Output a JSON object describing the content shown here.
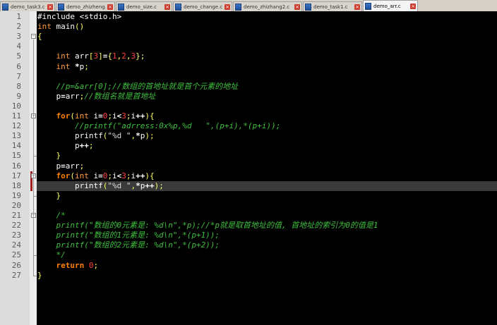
{
  "tabs": [
    {
      "label": "demo_task3.c",
      "active": false
    },
    {
      "label": "demo_zhizheng.c",
      "active": false
    },
    {
      "label": "demo_size.c",
      "active": false
    },
    {
      "label": "demo_change.c",
      "active": false
    },
    {
      "label": "demo_zhizhang2.c",
      "active": false
    },
    {
      "label": "demo_task1.c",
      "active": false
    },
    {
      "label": "demo_arr.c",
      "active": true
    }
  ],
  "current_line": 18,
  "lines": [
    {
      "n": "1",
      "tokens": [
        [
          "fn",
          "#include <stdio.h>"
        ]
      ]
    },
    {
      "n": "2",
      "tokens": [
        [
          "type",
          "int"
        ],
        [
          "fn",
          " main"
        ],
        [
          "sep",
          "()"
        ]
      ]
    },
    {
      "n": "3",
      "tokens": [
        [
          "sep",
          "{"
        ]
      ]
    },
    {
      "n": "4",
      "tokens": []
    },
    {
      "n": "5",
      "tokens": [
        [
          "type",
          "    int"
        ],
        [
          "fn",
          " arr"
        ],
        [
          "sep",
          "["
        ],
        [
          "num",
          "3"
        ],
        [
          "sep",
          "]"
        ],
        [
          "op",
          "="
        ],
        [
          "sep",
          "{"
        ],
        [
          "num",
          "1"
        ],
        [
          "sep",
          ","
        ],
        [
          "num",
          "2"
        ],
        [
          "sep",
          ","
        ],
        [
          "num",
          "3"
        ],
        [
          "sep",
          "};"
        ]
      ]
    },
    {
      "n": "6",
      "tokens": [
        [
          "type",
          "    int"
        ],
        [
          "op",
          " *"
        ],
        [
          "fn",
          "p"
        ],
        [
          "sep",
          ";"
        ]
      ]
    },
    {
      "n": "7",
      "tokens": []
    },
    {
      "n": "8",
      "tokens": [
        [
          "cmt",
          "    //p=&arr[0];//数组的首地址就是首个元素的地址"
        ]
      ]
    },
    {
      "n": "9",
      "tokens": [
        [
          "fn",
          "    p"
        ],
        [
          "op",
          "="
        ],
        [
          "fn",
          "arr"
        ],
        [
          "sep",
          ";"
        ],
        [
          "cmt",
          "//数组名就是首地址"
        ]
      ]
    },
    {
      "n": "10",
      "tokens": []
    },
    {
      "n": "11",
      "tokens": [
        [
          "kw",
          "    for"
        ],
        [
          "sep",
          "("
        ],
        [
          "type",
          "int"
        ],
        [
          "fn",
          " i"
        ],
        [
          "op",
          "="
        ],
        [
          "num",
          "0"
        ],
        [
          "sep",
          ";"
        ],
        [
          "fn",
          "i"
        ],
        [
          "op",
          "<"
        ],
        [
          "num",
          "3"
        ],
        [
          "sep",
          ";"
        ],
        [
          "fn",
          "i"
        ],
        [
          "op",
          "++"
        ],
        [
          "sep",
          "){"
        ]
      ]
    },
    {
      "n": "12",
      "tokens": [
        [
          "cmt",
          "        //printf(\"adrress:0x%p,%d   \",(p+i),*(p+i));"
        ]
      ]
    },
    {
      "n": "13",
      "tokens": [
        [
          "fn",
          "        printf"
        ],
        [
          "sep",
          "("
        ],
        [
          "str",
          "\"%d \""
        ],
        [
          "sep",
          ","
        ],
        [
          "op",
          "*"
        ],
        [
          "fn",
          "p"
        ],
        [
          "sep",
          ");"
        ]
      ]
    },
    {
      "n": "14",
      "tokens": [
        [
          "fn",
          "        p"
        ],
        [
          "op",
          "++"
        ],
        [
          "sep",
          ";"
        ]
      ]
    },
    {
      "n": "15",
      "tokens": [
        [
          "sep",
          "    }"
        ]
      ]
    },
    {
      "n": "16",
      "tokens": [
        [
          "fn",
          "    p"
        ],
        [
          "op",
          "="
        ],
        [
          "fn",
          "arr"
        ],
        [
          "sep",
          ";"
        ]
      ]
    },
    {
      "n": "17",
      "tokens": [
        [
          "kw",
          "    for"
        ],
        [
          "sep",
          "("
        ],
        [
          "type",
          "int"
        ],
        [
          "fn",
          " i"
        ],
        [
          "op",
          "="
        ],
        [
          "num",
          "0"
        ],
        [
          "sep",
          ";"
        ],
        [
          "fn",
          "i"
        ],
        [
          "op",
          "<"
        ],
        [
          "num",
          "3"
        ],
        [
          "sep",
          ";"
        ],
        [
          "fn",
          "i"
        ],
        [
          "op",
          "++"
        ],
        [
          "sep",
          "){"
        ]
      ]
    },
    {
      "n": "18",
      "tokens": [
        [
          "fn",
          "        printf"
        ],
        [
          "sep",
          "("
        ],
        [
          "str",
          "\"%d \""
        ],
        [
          "sep",
          ","
        ],
        [
          "op",
          "*"
        ],
        [
          "fn",
          "p"
        ],
        [
          "op",
          "++"
        ],
        [
          "sep",
          ");"
        ]
      ]
    },
    {
      "n": "19",
      "tokens": [
        [
          "sep",
          "    }"
        ]
      ]
    },
    {
      "n": "20",
      "tokens": []
    },
    {
      "n": "21",
      "tokens": [
        [
          "cmt",
          "    /*"
        ]
      ]
    },
    {
      "n": "22",
      "tokens": [
        [
          "cmt",
          "    printf(\"数组的0元素是: %d\\n\",*p);//*p就是取首地址的值, 首地址的索引为0的值是1"
        ]
      ]
    },
    {
      "n": "23",
      "tokens": [
        [
          "cmt",
          "    printf(\"数组的1元素是: %d\\n\",*(p+1));"
        ]
      ]
    },
    {
      "n": "24",
      "tokens": [
        [
          "cmt",
          "    printf(\"数组的2元素是: %d\\n\",*(p+2));"
        ]
      ]
    },
    {
      "n": "25",
      "tokens": [
        [
          "cmt",
          "    */"
        ]
      ]
    },
    {
      "n": "26",
      "tokens": [
        [
          "kw",
          "    return"
        ],
        [
          "num",
          " 0"
        ],
        [
          "sep",
          ";"
        ]
      ]
    },
    {
      "n": "27",
      "tokens": [
        [
          "sep",
          "}"
        ]
      ]
    }
  ],
  "folds": [
    3,
    11,
    17,
    21
  ],
  "breakpoint_lines": [
    17,
    18
  ]
}
